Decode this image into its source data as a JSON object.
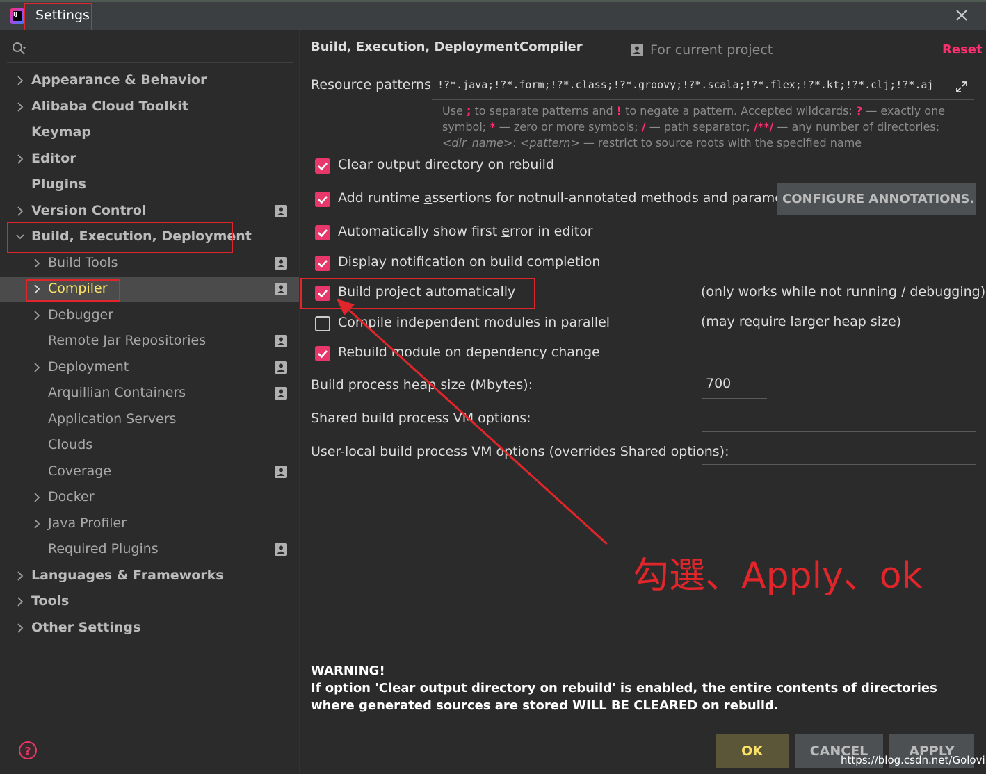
{
  "window": {
    "title": "Settings"
  },
  "sidebar": {
    "items": [
      {
        "label": "Appearance & Behavior",
        "level": 0,
        "chevron": "right"
      },
      {
        "label": "Alibaba Cloud Toolkit",
        "level": 0,
        "chevron": "right"
      },
      {
        "label": "Keymap",
        "level": 0,
        "chevron": "none"
      },
      {
        "label": "Editor",
        "level": 0,
        "chevron": "right"
      },
      {
        "label": "Plugins",
        "level": 0,
        "chevron": "none"
      },
      {
        "label": "Version Control",
        "level": 0,
        "chevron": "right",
        "project_icon": true
      },
      {
        "label": "Build, Execution, Deployment",
        "level": 0,
        "chevron": "down"
      },
      {
        "label": "Build Tools",
        "level": 1,
        "chevron": "right",
        "project_icon": true
      },
      {
        "label": "Compiler",
        "level": 1,
        "chevron": "right",
        "project_icon": true,
        "selected": true
      },
      {
        "label": "Debugger",
        "level": 1,
        "chevron": "right"
      },
      {
        "label": "Remote Jar Repositories",
        "level": 1,
        "chevron": "none",
        "project_icon": true
      },
      {
        "label": "Deployment",
        "level": 1,
        "chevron": "right",
        "project_icon": true
      },
      {
        "label": "Arquillian Containers",
        "level": 1,
        "chevron": "none",
        "project_icon": true
      },
      {
        "label": "Application Servers",
        "level": 1,
        "chevron": "none"
      },
      {
        "label": "Clouds",
        "level": 1,
        "chevron": "none"
      },
      {
        "label": "Coverage",
        "level": 1,
        "chevron": "none",
        "project_icon": true
      },
      {
        "label": "Docker",
        "level": 1,
        "chevron": "right"
      },
      {
        "label": "Java Profiler",
        "level": 1,
        "chevron": "right"
      },
      {
        "label": "Required Plugins",
        "level": 1,
        "chevron": "none",
        "project_icon": true
      },
      {
        "label": "Languages & Frameworks",
        "level": 0,
        "chevron": "right"
      },
      {
        "label": "Tools",
        "level": 0,
        "chevron": "right"
      },
      {
        "label": "Other Settings",
        "level": 0,
        "chevron": "right"
      }
    ]
  },
  "header": {
    "breadcrumb_parent": "Build, Execution, Deployment",
    "breadcrumb_separator": "›",
    "breadcrumb_current": "Compiler",
    "scope_label": "For current project",
    "reset_label": "Reset"
  },
  "resource_patterns": {
    "label": "Resource patterns:",
    "value": "!?*.java;!?*.form;!?*.class;!?*.groovy;!?*.scala;!?*.flex;!?*.kt;!?*.clj;!?*.aj",
    "hint_use": "Use",
    "hint_semicolon": ";",
    "hint_to_separate": "to separate patterns and",
    "hint_bang": "!",
    "hint_to_negate": "to negate a pattern. Accepted wildcards:",
    "hint_q": "?",
    "hint_exactly_one": "— exactly one symbol;",
    "hint_star": "*",
    "hint_zero_or_more": "— zero or more symbols;",
    "hint_slash": "/",
    "hint_path_sep": "— path separator;",
    "hint_dstar": "/**/",
    "hint_any_dirs": "— any number of directories;",
    "hint_dir_name": "<dir_name>",
    "hint_colon": ":",
    "hint_pattern": "<pattern>",
    "hint_restrict": "— restrict to source roots with the specified name"
  },
  "options": {
    "clear_output": {
      "pre": "C",
      "u": "l",
      "post": "ear output directory on rebuild",
      "checked": true
    },
    "runtime_assertions": {
      "pre": "Add runtime ",
      "u": "a",
      "post": "ssertions for notnull-annotated methods and parameters",
      "checked": true
    },
    "show_first_error": {
      "pre": "Automatically show first ",
      "u": "e",
      "post": "rror in editor",
      "checked": true
    },
    "display_notification": {
      "pre": "Display notification on build completion",
      "u": "",
      "post": "",
      "checked": true
    },
    "build_automatically": {
      "pre": "Build project automatically",
      "u": "",
      "post": "",
      "checked": true
    },
    "compile_parallel": {
      "pre": "Compile independent modules in parallel",
      "u": "",
      "post": "",
      "checked": false
    },
    "rebuild_on_dependency": {
      "pre": "Rebuild module on dependency change",
      "u": "",
      "post": "",
      "checked": true
    }
  },
  "configure_annotations": {
    "u": "C",
    "rest": "ONFIGURE ANNOTATIONS..."
  },
  "notes": {
    "build_auto_note": "(only works while not running / debugging)",
    "parallel_note": "(may require larger heap size)"
  },
  "heap": {
    "label": "Build process heap size (Mbytes):",
    "value": "700"
  },
  "shared_vm": {
    "label": "Shared build process VM options:",
    "value": ""
  },
  "user_vm": {
    "label": "User-local build process VM options (overrides Shared options):",
    "value": ""
  },
  "warning": {
    "title": "WARNING!",
    "body": "If option 'Clear output directory on rebuild' is enabled, the entire contents of directories where generated sources are stored WILL BE CLEARED on rebuild."
  },
  "buttons": {
    "ok": "OK",
    "cancel": "CANCEL",
    "apply": "APPLY"
  },
  "annotation": {
    "text": "勾選、Apply、ok",
    "color": "#e0262b"
  },
  "watermark": "https://blog.csdn.net/Golovin",
  "colors": {
    "accent": "#e8386b",
    "selected_text": "#fce267",
    "reset": "#fc2e6f",
    "background": "#2b2b2b"
  }
}
